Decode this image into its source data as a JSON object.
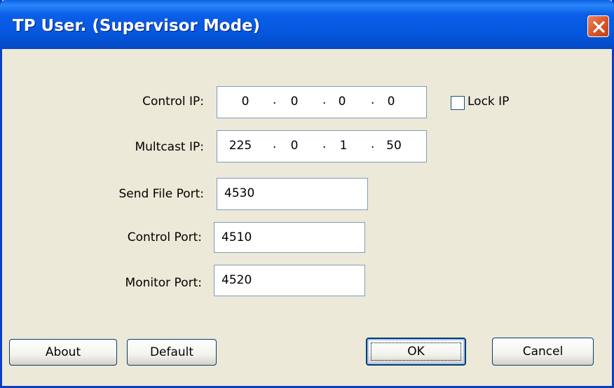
{
  "window": {
    "title": "TP User. (Supervisor Mode)",
    "close_icon": "close-icon"
  },
  "form": {
    "control_ip": {
      "label": "Control IP:",
      "octets": [
        "0",
        "0",
        "0",
        "0"
      ]
    },
    "multicast_ip": {
      "label": "Multcast IP:",
      "octets": [
        "225",
        "0",
        "1",
        "50"
      ]
    },
    "lock_ip": {
      "label": "Lock IP",
      "checked": false
    },
    "send_file_port": {
      "label": "Send File Port:",
      "value": "4530"
    },
    "control_port": {
      "label": "Control Port:",
      "value": "4510"
    },
    "monitor_port": {
      "label": "Monitor Port:",
      "value": "4520"
    }
  },
  "buttons": {
    "about": "About",
    "default": "Default",
    "ok": "OK",
    "cancel": "Cancel"
  },
  "colors": {
    "titlebar": "#0556DC",
    "face": "#ECE9D8",
    "close": "#D95830"
  }
}
